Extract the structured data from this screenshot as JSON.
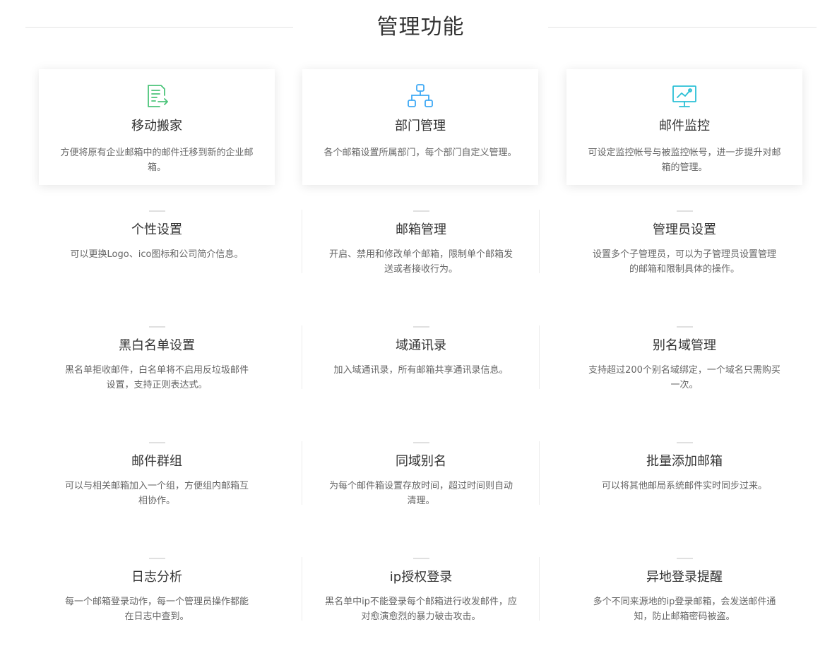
{
  "header": {
    "title": "管理功能"
  },
  "cards": [
    {
      "icon": "file-transfer-icon",
      "title": "移动搬家",
      "desc": "方便将原有企业邮箱中的邮件迁移到新的企业邮箱。",
      "color": "#4cc47a"
    },
    {
      "icon": "org-chart-icon",
      "title": "部门管理",
      "desc": "各个邮箱设置所属部门，每个部门自定义管理。",
      "color": "#3fa9f5"
    },
    {
      "icon": "monitor-chart-icon",
      "title": "邮件监控",
      "desc": "可设定监控帐号与被监控帐号，进一步提升对邮箱的管理。",
      "color": "#2cc0d6"
    }
  ],
  "grid": [
    {
      "title": "个性设置",
      "desc": "可以更换Logo、ico图标和公司简介信息。"
    },
    {
      "title": "邮箱管理",
      "desc": "开启、禁用和修改单个邮箱，限制单个邮箱发送或者接收行为。"
    },
    {
      "title": "管理员设置",
      "desc": "设置多个子管理员，可以为子管理员设置管理的邮箱和限制具体的操作。"
    },
    {
      "title": "黑白名单设置",
      "desc": "黑名单拒收邮件，白名单将不启用反垃圾邮件设置，支持正则表达式。"
    },
    {
      "title": "域通讯录",
      "desc": "加入域通讯录，所有邮箱共享通讯录信息。"
    },
    {
      "title": "别名域管理",
      "desc": "支持超过200个别名域绑定，一个域名只需购买一次。"
    },
    {
      "title": "邮件群组",
      "desc": "可以与相关邮箱加入一个组，方便组内邮箱互相协作。"
    },
    {
      "title": "同域别名",
      "desc": "为每个邮件箱设置存放时间，超过时间则自动清理。"
    },
    {
      "title": "批量添加邮箱",
      "desc": "可以将其他邮局系统邮件实时同步过来。"
    },
    {
      "title": "日志分析",
      "desc": "每一个邮箱登录动作，每一个管理员操作都能在日志中查到。"
    },
    {
      "title": "ip授权登录",
      "desc": "黑名单中ip不能登录每个邮箱进行收发邮件，应对愈演愈烈的暴力破击攻击。"
    },
    {
      "title": "异地登录提醒",
      "desc": "多个不同来源地的ip登录邮箱，会发送邮件通知，防止邮箱密码被盗。"
    }
  ]
}
